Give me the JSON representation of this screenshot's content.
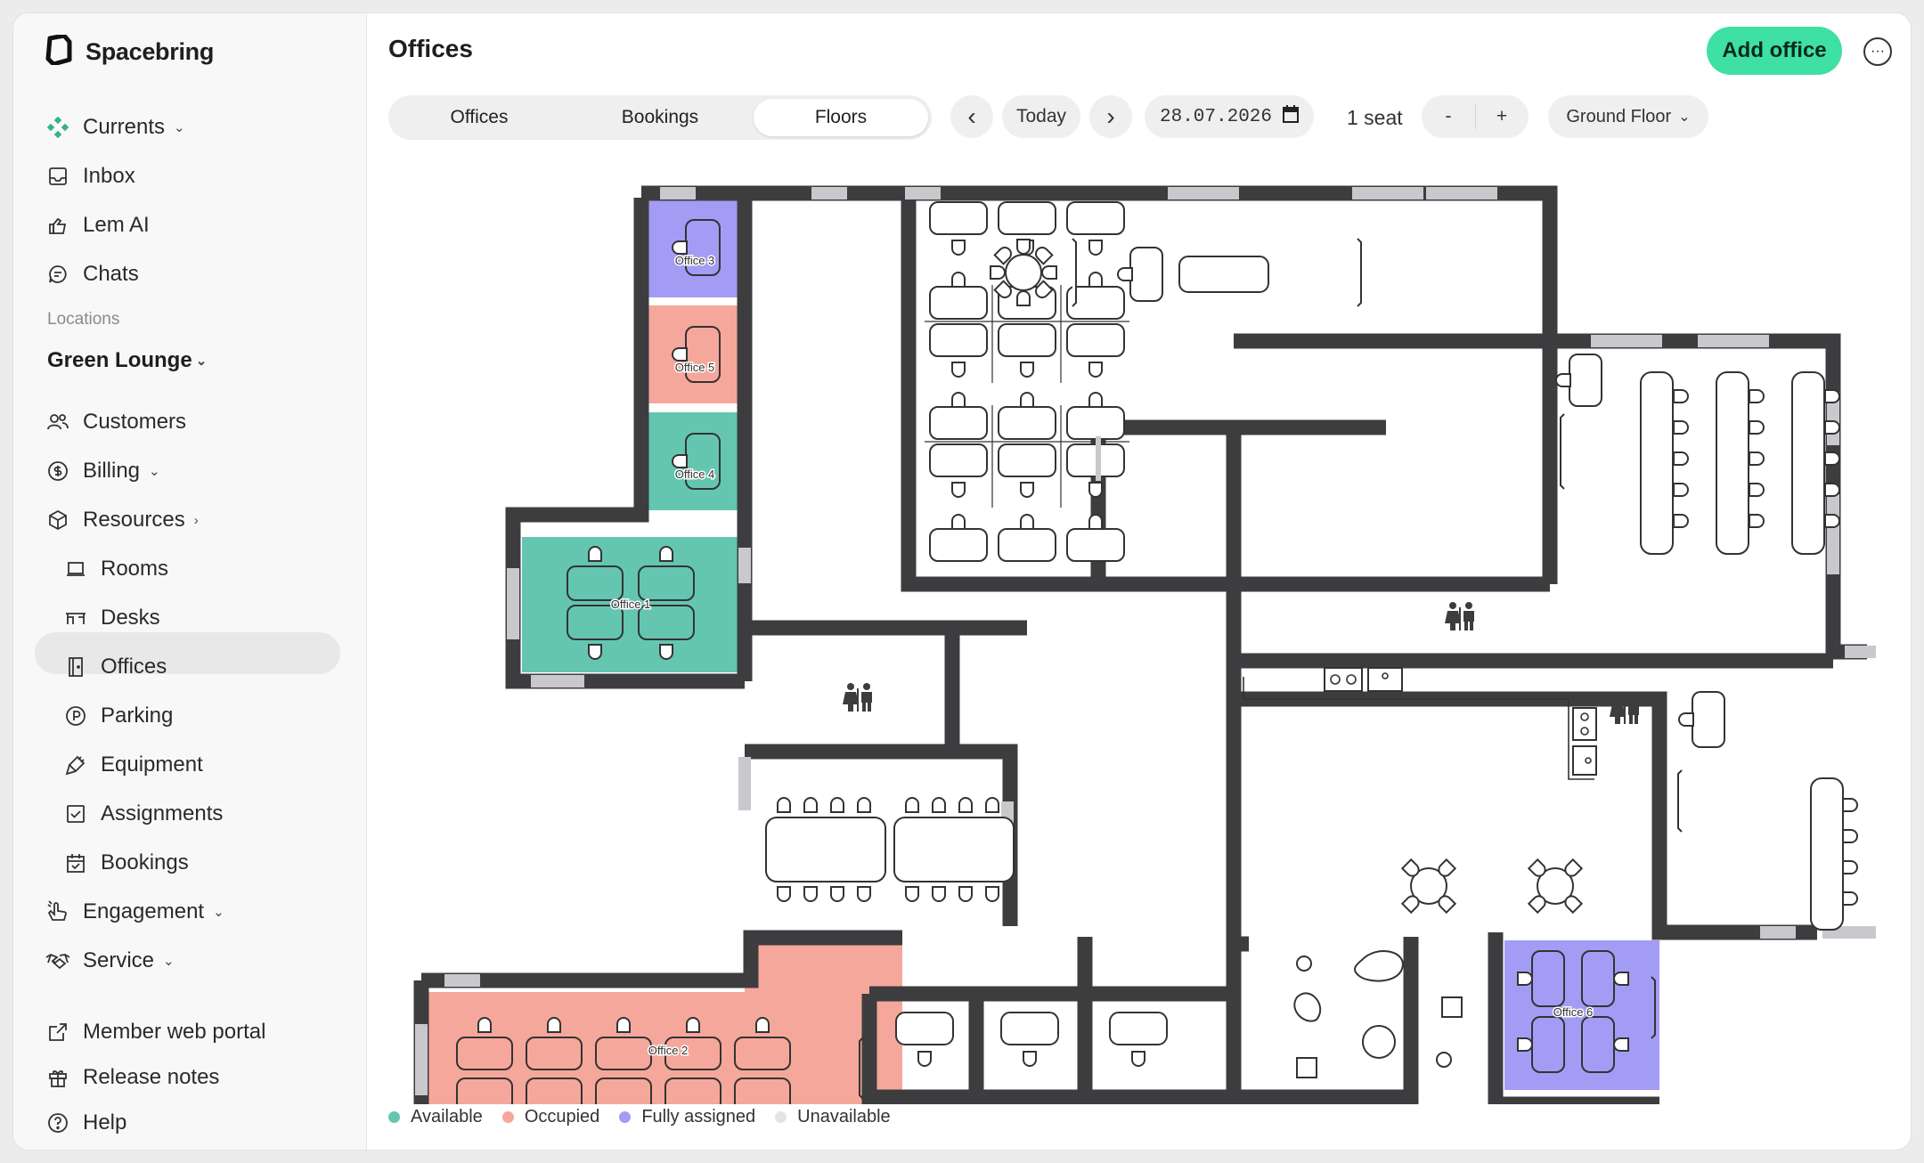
{
  "app": {
    "name": "Spacebring"
  },
  "sidebar": {
    "top_items": [
      {
        "label": "Currents",
        "icon": "currents-icon",
        "chevron": "⌄"
      },
      {
        "label": "Inbox",
        "icon": "inbox-icon"
      },
      {
        "label": "Lem AI",
        "icon": "lem-ai-icon"
      },
      {
        "label": "Chats",
        "icon": "chat-icon"
      }
    ],
    "section_label": "Locations",
    "location_name": "Green Lounge",
    "location_chevron": "⌄",
    "items": [
      {
        "label": "Customers",
        "icon": "customers-icon"
      },
      {
        "label": "Billing",
        "icon": "billing-icon",
        "chevron": "⌄"
      },
      {
        "label": "Resources",
        "icon": "resources-icon",
        "chevron": "›"
      },
      {
        "label": "Rooms",
        "icon": "rooms-icon"
      },
      {
        "label": "Desks",
        "icon": "desks-icon"
      },
      {
        "label": "Offices",
        "icon": "offices-icon"
      },
      {
        "label": "Parking",
        "icon": "parking-icon"
      },
      {
        "label": "Equipment",
        "icon": "equipment-icon"
      },
      {
        "label": "Assignments",
        "icon": "assignments-icon"
      },
      {
        "label": "Bookings",
        "icon": "bookings-icon"
      },
      {
        "label": "Engagement",
        "icon": "engagement-icon",
        "chevron": "⌄"
      },
      {
        "label": "Service",
        "icon": "service-icon",
        "chevron": "⌄"
      }
    ],
    "footer": [
      {
        "label": "Member web portal",
        "icon": "external-link-icon"
      },
      {
        "label": "Release notes",
        "icon": "gift-icon"
      },
      {
        "label": "Help",
        "icon": "help-icon"
      }
    ],
    "active_item": "Offices"
  },
  "header": {
    "title": "Offices",
    "add_label": "Add office",
    "more_icon": "more-icon",
    "more_glyph": "···"
  },
  "toolbar": {
    "tabs": [
      "Offices",
      "Bookings",
      "Floors"
    ],
    "active_tab": "Floors",
    "prev_glyph": "‹",
    "next_glyph": "›",
    "today_label": "Today",
    "date": "28.07.2026",
    "calendar_icon": "calendar-icon",
    "seats": "1 seat",
    "minus": "-",
    "plus": "+",
    "floor": "Ground Floor",
    "floor_chevron": "⌄"
  },
  "floorplan": {
    "offices": [
      {
        "label": "Office 3",
        "status": "Fully assigned"
      },
      {
        "label": "Office 5",
        "status": "Occupied"
      },
      {
        "label": "Office 4",
        "status": "Available"
      },
      {
        "label": "Office 1",
        "status": "Available"
      },
      {
        "label": "Office 2",
        "status": "Occupied"
      },
      {
        "label": "Office 6",
        "status": "Fully assigned"
      }
    ]
  },
  "legend": [
    {
      "label": "Available",
      "color": "#64c6b0"
    },
    {
      "label": "Occupied",
      "color": "#f6a79b"
    },
    {
      "label": "Fully assigned",
      "color": "#a39cf5"
    },
    {
      "label": "Unavailable",
      "color": "#e4e4e4"
    }
  ],
  "colors": {
    "accent": "#3ee0a4",
    "wall": "#3d3d3f"
  }
}
